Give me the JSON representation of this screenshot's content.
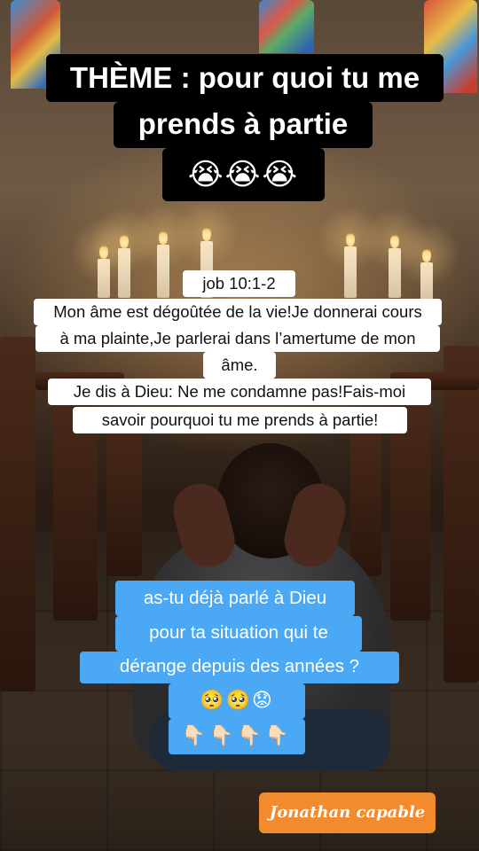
{
  "title": {
    "line1": "THÈME : pour quoi tu me",
    "line2": "prends à partie",
    "emojis": "😭😭😭"
  },
  "verse": {
    "reference": "job 10:1-2",
    "lines": [
      "Mon âme est dégoûtée de la vie!Je donnerai cours",
      "à ma plainte,Je parlerai dans l’amertume de mon",
      "âme.",
      "Je dis à Dieu: Ne me condamne pas!Fais-moi",
      "savoir pourquoi tu me prends à partie!"
    ]
  },
  "question": {
    "lines": [
      "as-tu déjà parlé à Dieu",
      "pour ta situation qui te",
      "dérange depuis des années ?"
    ],
    "emojis_faces": "🥺🥺😟",
    "emojis_hands": "👇🏻👇🏻👇🏻👇🏻"
  },
  "signature": "Jonathan capable",
  "colors": {
    "question_bubble": "#4aa8f4",
    "signature_bubble": "#f28a2e",
    "title_bubble": "#000000",
    "verse_bubble": "#ffffff"
  }
}
